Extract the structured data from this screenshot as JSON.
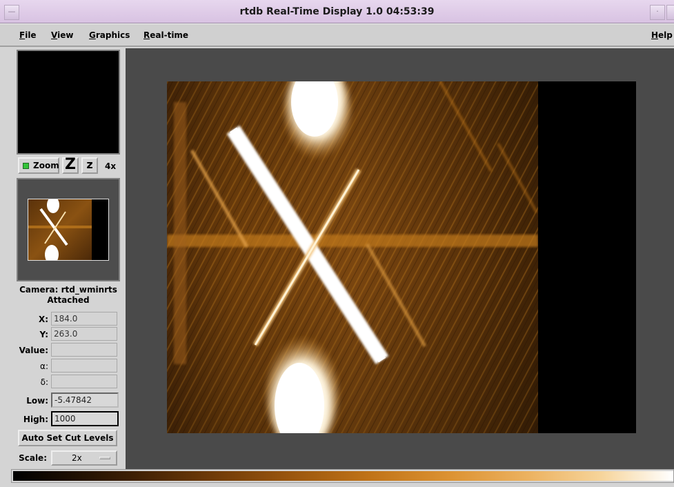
{
  "window": {
    "title": "rtdb Real-Time Display 1.0  04:53:39"
  },
  "menu": {
    "file": "File",
    "view": "View",
    "graphics": "Graphics",
    "realtime": "Real-time",
    "help": "Help"
  },
  "zoom": {
    "zoom_label": "Zoom",
    "zoom_in_label": "Z",
    "zoom_out_label": "z",
    "factor": "4x"
  },
  "camera": {
    "line1": "Camera: rtd_wminrts",
    "line2": "Attached"
  },
  "fields": {
    "x_label": "X:",
    "x_value": "184.0",
    "y_label": "Y:",
    "y_value": "263.0",
    "value_label": "Value:",
    "value_value": "",
    "alpha_label": "α:",
    "alpha_value": "",
    "delta_label": "δ:",
    "delta_value": "",
    "low_label": "Low:",
    "low_value": "-5.47842",
    "high_label": "High:",
    "high_value": "1000"
  },
  "controls": {
    "auto_cut_label": "Auto Set Cut Levels",
    "scale_label": "Scale:",
    "scale_value": "2x"
  },
  "colors": {
    "title_bar": "#dccbe6",
    "image_highlight": "#ffffff",
    "image_mid": "#c27a1a",
    "image_dark": "#3a1f05",
    "canvas_bg": "#4a4a4a",
    "zoom_led": "#34c43a"
  }
}
